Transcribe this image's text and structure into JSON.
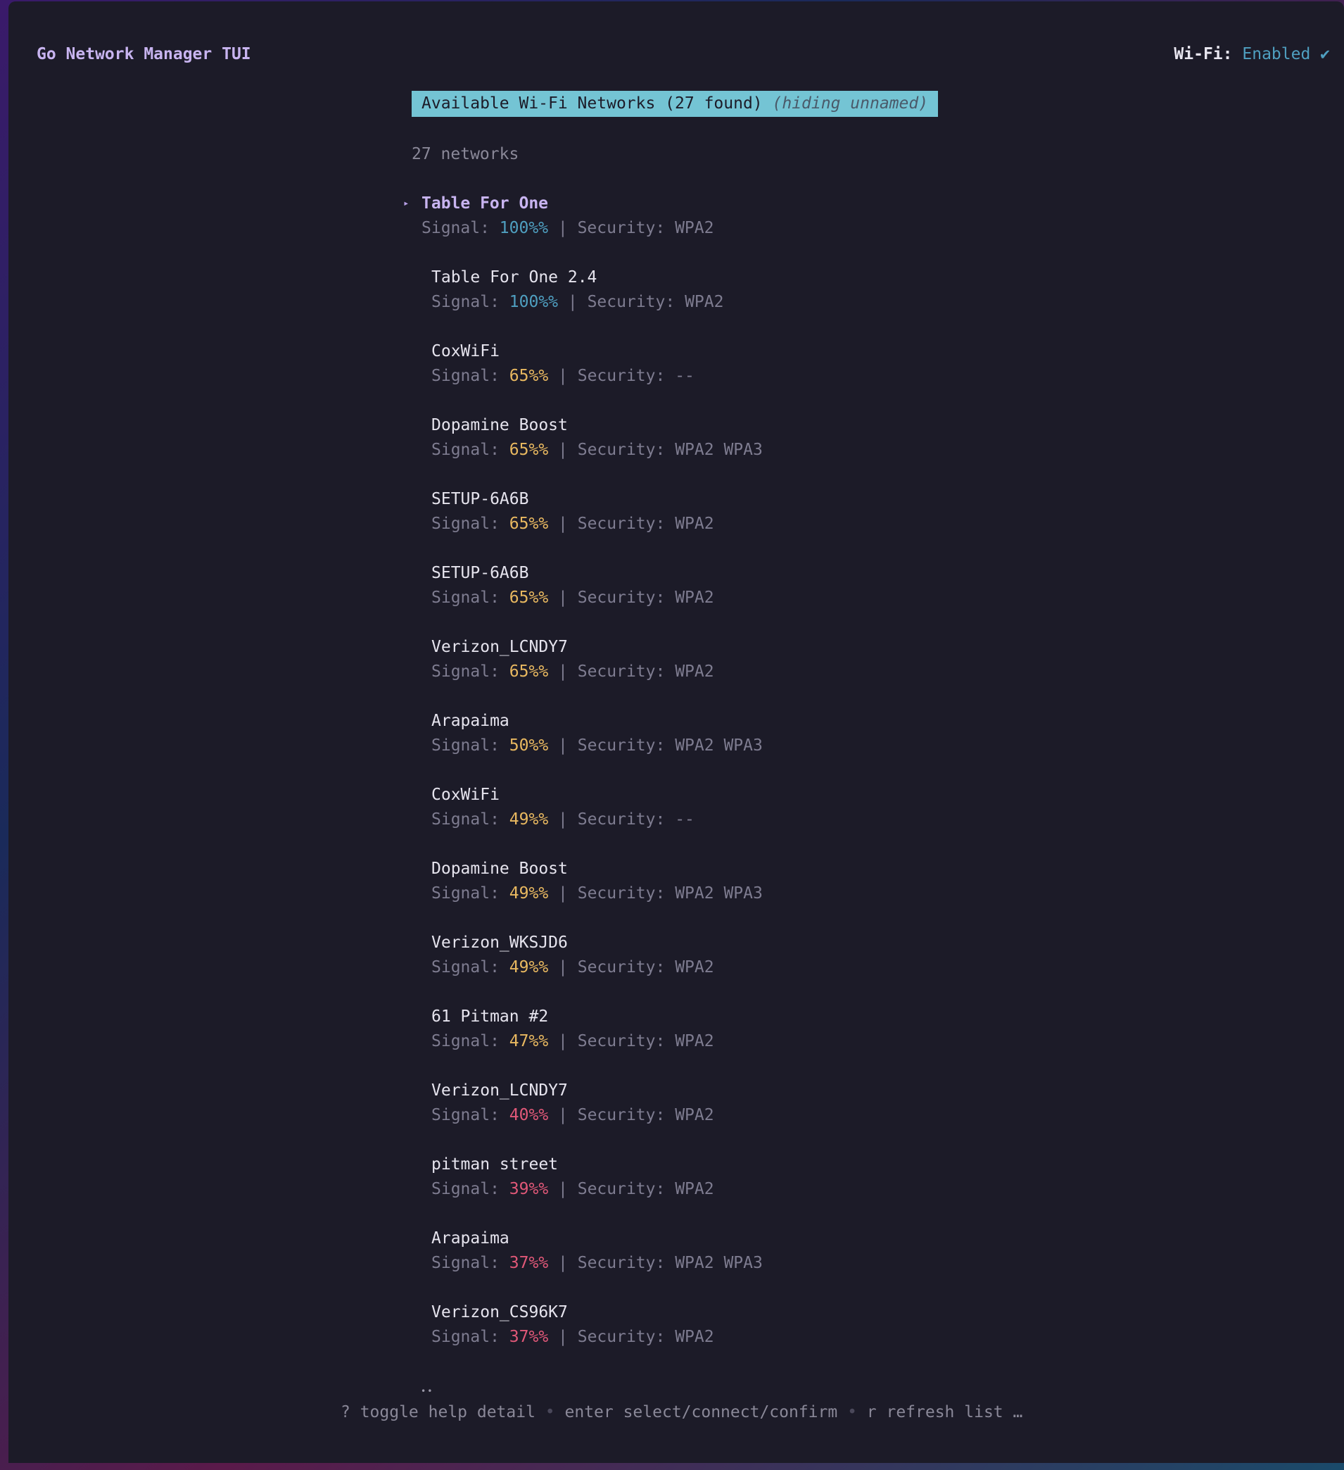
{
  "app": {
    "title": "Go Network Manager TUI",
    "wifi_label": "Wi-Fi:",
    "wifi_state": "Enabled ✔"
  },
  "header": {
    "title": "Available Wi-Fi Networks (27 found)",
    "note": "(hiding unnamed)"
  },
  "count_label": "27 networks",
  "signal_label": "Signal:",
  "security_label": "Security:",
  "selected_marker": "▸",
  "networks": [
    {
      "name": "Table For One",
      "signal": "100%%",
      "level": "high",
      "security": "WPA2",
      "selected": true
    },
    {
      "name": "Table For One 2.4",
      "signal": "100%%",
      "level": "high",
      "security": "WPA2"
    },
    {
      "name": "CoxWiFi",
      "signal": "65%%",
      "level": "mid",
      "security": "--"
    },
    {
      "name": "Dopamine Boost",
      "signal": "65%%",
      "level": "mid",
      "security": "WPA2 WPA3"
    },
    {
      "name": "SETUP-6A6B",
      "signal": "65%%",
      "level": "mid",
      "security": "WPA2"
    },
    {
      "name": "SETUP-6A6B",
      "signal": "65%%",
      "level": "mid",
      "security": "WPA2"
    },
    {
      "name": "Verizon_LCNDY7",
      "signal": "65%%",
      "level": "mid",
      "security": "WPA2"
    },
    {
      "name": "Arapaima",
      "signal": "50%%",
      "level": "mid",
      "security": "WPA2 WPA3"
    },
    {
      "name": "CoxWiFi",
      "signal": "49%%",
      "level": "mid",
      "security": "--"
    },
    {
      "name": "Dopamine Boost",
      "signal": "49%%",
      "level": "mid",
      "security": "WPA2 WPA3"
    },
    {
      "name": "Verizon_WKSJD6",
      "signal": "49%%",
      "level": "mid",
      "security": "WPA2"
    },
    {
      "name": "61 Pitman #2",
      "signal": "47%%",
      "level": "mid",
      "security": "WPA2"
    },
    {
      "name": "Verizon_LCNDY7",
      "signal": "40%%",
      "level": "low",
      "security": "WPA2"
    },
    {
      "name": "pitman street",
      "signal": "39%%",
      "level": "low",
      "security": "WPA2"
    },
    {
      "name": "Arapaima",
      "signal": "37%%",
      "level": "low",
      "security": "WPA2 WPA3"
    },
    {
      "name": "Verizon_CS96K7",
      "signal": "37%%",
      "level": "low",
      "security": "WPA2"
    }
  ],
  "pager": "••",
  "help": {
    "items": [
      "? toggle help detail",
      "enter select/connect/confirm",
      "r refresh list …"
    ],
    "separator": "•"
  },
  "colors": {
    "background": "#1c1b28",
    "accent": "#c8b4f0",
    "header_bg": "#74c4d4",
    "signal_high": "#4f9fc0",
    "signal_mid": "#e8b860",
    "signal_low": "#e05878"
  }
}
